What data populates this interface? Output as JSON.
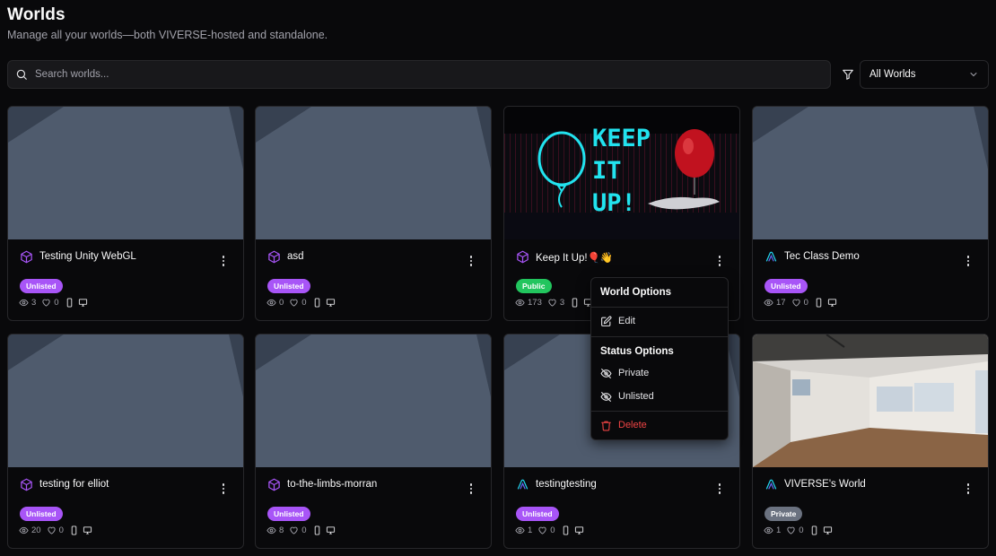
{
  "header": {
    "title": "Worlds",
    "subtitle": "Manage all your worlds—both VIVERSE-hosted and standalone."
  },
  "search": {
    "placeholder": "Search worlds..."
  },
  "filter": {
    "selected": "All Worlds"
  },
  "colors": {
    "unlisted": "#a855f7",
    "public": "#22c55e",
    "private": "#6b7280",
    "delete": "#ef4444"
  },
  "cards": [
    {
      "name": "Testing Unity WebGL",
      "icon": "cube-icon",
      "status": "Unlisted",
      "views": "3",
      "likes": "0",
      "thumb": "placeholder"
    },
    {
      "name": "asd",
      "icon": "cube-icon",
      "status": "Unlisted",
      "views": "0",
      "likes": "0",
      "thumb": "placeholder"
    },
    {
      "name": "Keep It Up!🎈👋",
      "icon": "cube-icon",
      "status": "Public",
      "views": "173",
      "likes": "3",
      "thumb": "keep-it-up",
      "thumb_text": [
        "KEEP",
        "IT",
        "UP!"
      ]
    },
    {
      "name": "Tec Class Demo",
      "icon": "viverse-icon",
      "status": "Unlisted",
      "views": "17",
      "likes": "0",
      "thumb": "placeholder"
    },
    {
      "name": "testing for elliot",
      "icon": "cube-icon",
      "status": "Unlisted",
      "views": "20",
      "likes": "0",
      "thumb": "placeholder"
    },
    {
      "name": "to-the-limbs-morran",
      "icon": "cube-icon",
      "status": "Unlisted",
      "views": "8",
      "likes": "0",
      "thumb": "placeholder"
    },
    {
      "name": "testingtesting",
      "icon": "viverse-icon",
      "status": "Unlisted",
      "views": "1",
      "likes": "0",
      "thumb": "placeholder"
    },
    {
      "name": "VIVERSE's World",
      "icon": "viverse-icon",
      "status": "Private",
      "views": "1",
      "likes": "0",
      "thumb": "room"
    }
  ],
  "menu": {
    "world_options": "World Options",
    "edit": "Edit",
    "status_options": "Status Options",
    "private": "Private",
    "unlisted": "Unlisted",
    "delete": "Delete"
  }
}
